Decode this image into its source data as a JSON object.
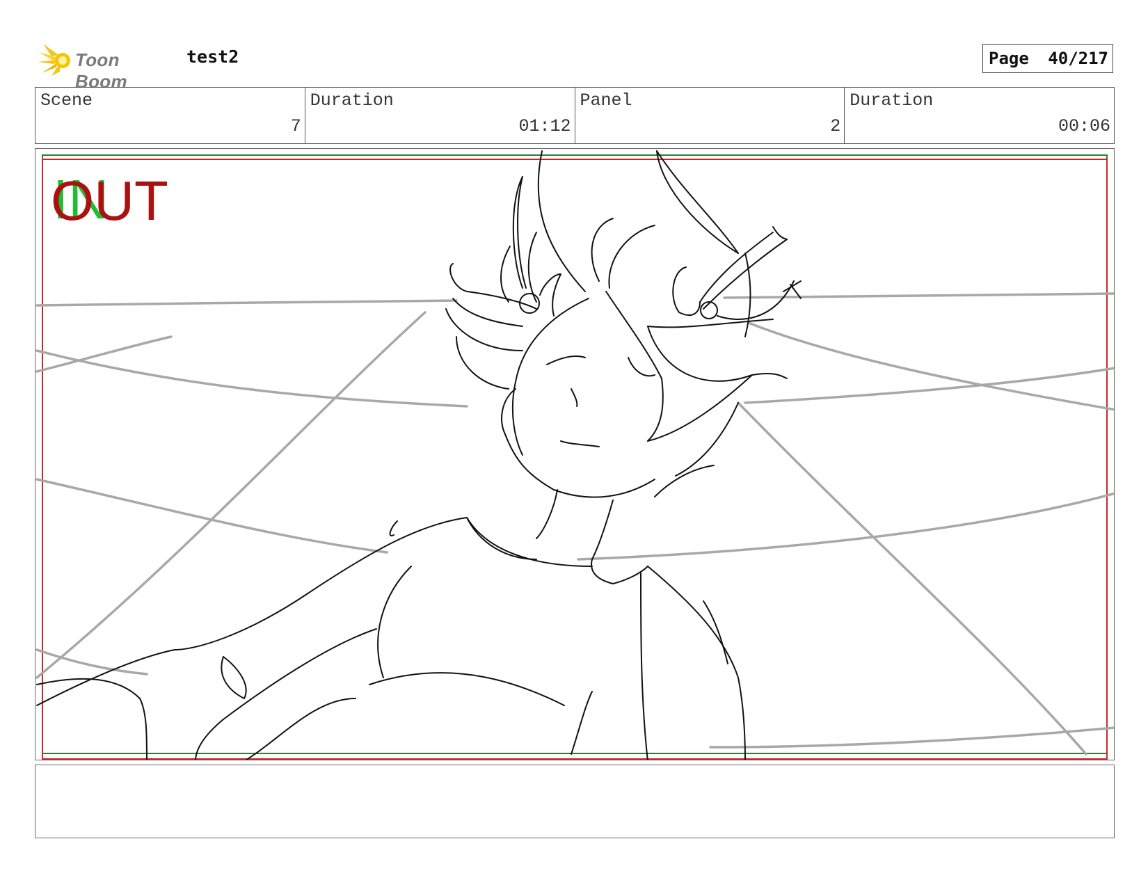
{
  "header": {
    "logo_text": "Toon Boom",
    "project_title": "test2",
    "page_label": "Page",
    "page_value": "40/217"
  },
  "info": {
    "scene_label": "Scene",
    "scene_value": "7",
    "scene_duration_label": "Duration",
    "scene_duration_value": "01:12",
    "panel_label": "Panel",
    "panel_value": "2",
    "panel_duration_label": "Duration",
    "panel_duration_value": "00:06"
  },
  "panel": {
    "in_marker": "IN",
    "out_marker": "OUT"
  },
  "notes": {
    "text": ""
  },
  "colors": {
    "in_marker": "#22bb33",
    "out_marker": "#aa1111",
    "safe_green": "#2e7d32",
    "safe_red": "#c62828",
    "guide_gray": "#a8a8a8",
    "logo_flare": "#f5c518"
  }
}
